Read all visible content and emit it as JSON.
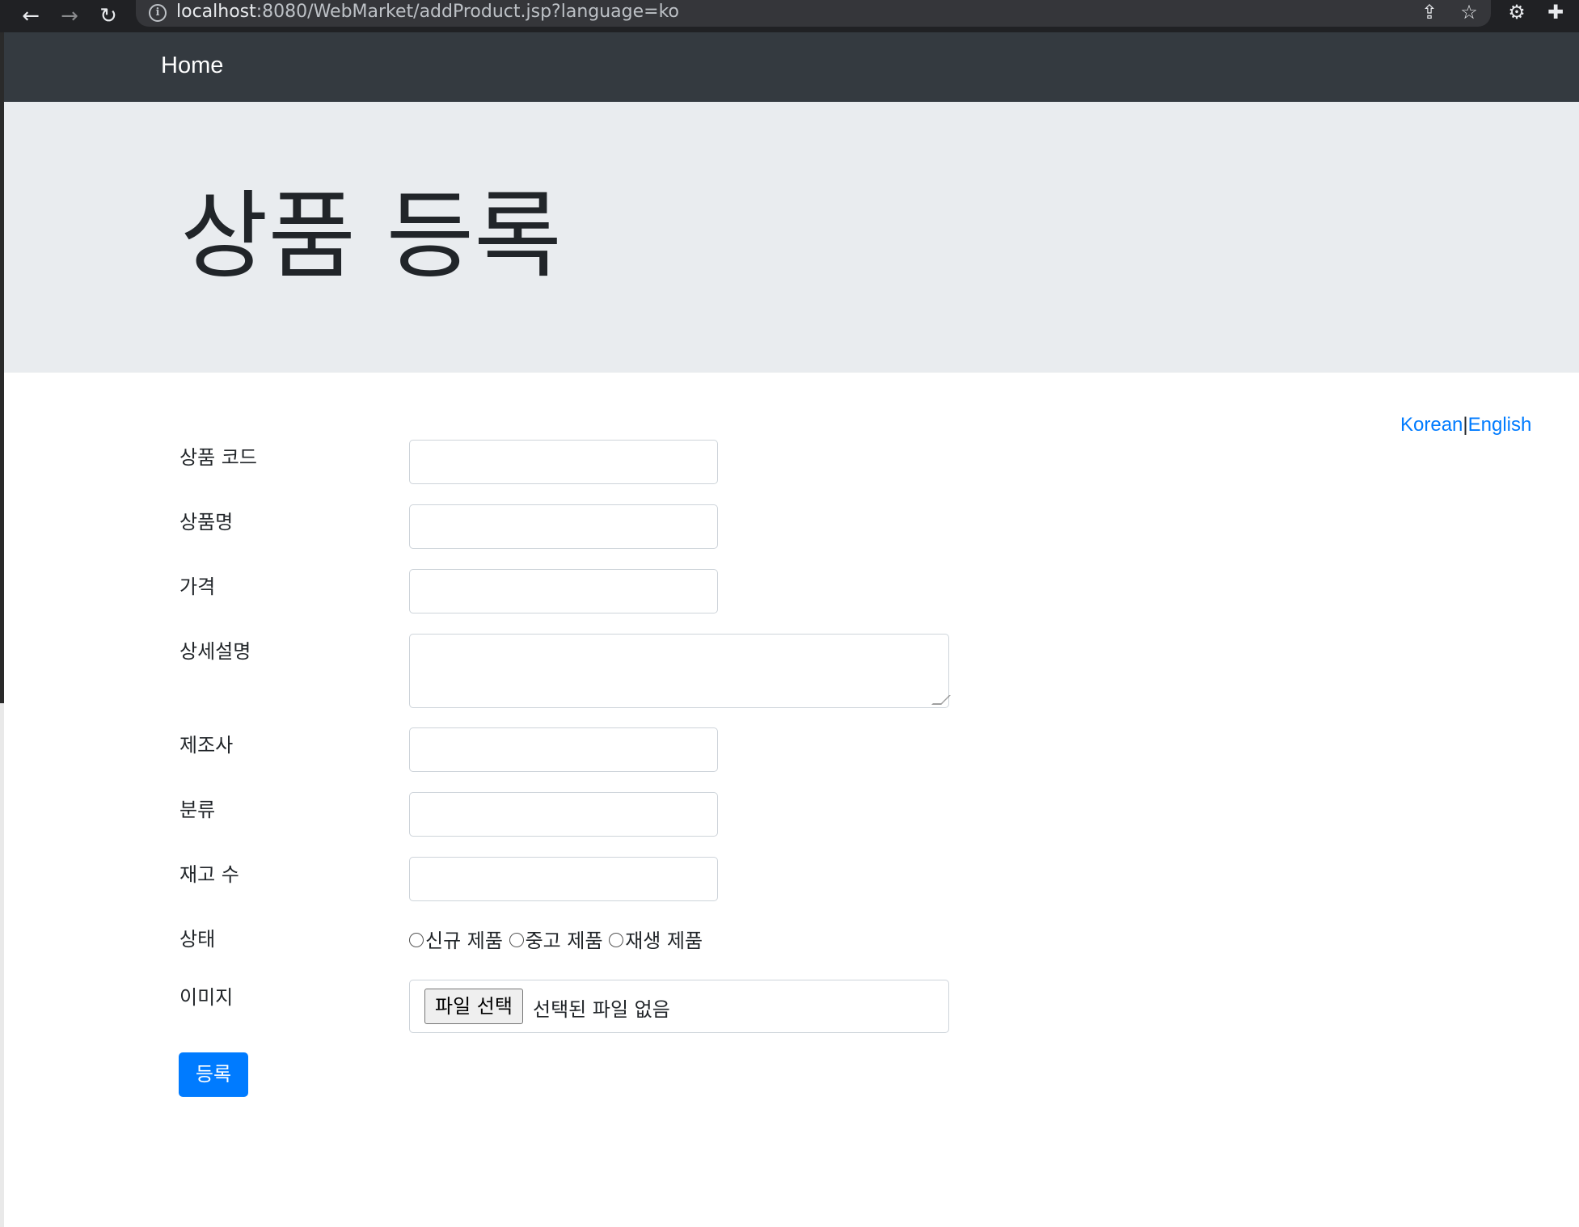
{
  "browser": {
    "url_host": "localhost",
    "url_rest": ":8080/WebMarket/addProduct.jsp?language=ko",
    "icons": [
      "back-arrow-icon",
      "forward-arrow-icon",
      "reload-icon",
      "info-icon",
      "share-icon",
      "star-icon",
      "settings-extension-icon",
      "puzzle-icon"
    ]
  },
  "navbar": {
    "brand": "Home"
  },
  "jumbotron": {
    "title": "상품 등록"
  },
  "language": {
    "korean": "Korean",
    "separator": "|",
    "english": "English"
  },
  "form": {
    "fields": [
      {
        "label": "상품 코드"
      },
      {
        "label": "상품명"
      },
      {
        "label": "가격"
      },
      {
        "label": "상세설명"
      },
      {
        "label": "제조사"
      },
      {
        "label": "분류"
      },
      {
        "label": "재고 수"
      }
    ],
    "condition": {
      "label": "상태",
      "options": [
        "신규 제품",
        "중고 제품",
        "재생 제품"
      ]
    },
    "image": {
      "label": "이미지",
      "button": "파일 선택",
      "status": "선택된 파일 없음"
    },
    "submit": "등록"
  }
}
